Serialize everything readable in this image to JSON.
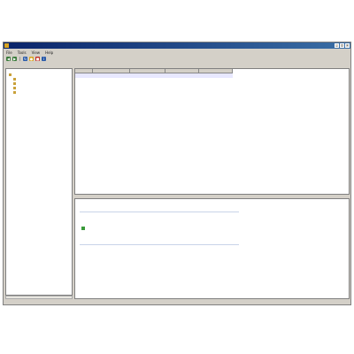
{
  "window": {
    "title": "",
    "controls": [
      "_",
      "□",
      "×"
    ]
  },
  "menubar": {
    "items": [
      "File",
      "Tools",
      "View",
      "Help"
    ]
  },
  "toolbar": {
    "tools": [
      {
        "name": "back",
        "glyph": "◀",
        "color": "#3a7a3a"
      },
      {
        "name": "forward",
        "glyph": "▶",
        "color": "#3a7a3a"
      },
      {
        "name": "refresh",
        "glyph": "↻",
        "color": "#2a5aa8"
      },
      {
        "name": "connect",
        "glyph": "●",
        "color": "#d9a521"
      },
      {
        "name": "stop",
        "glyph": "■",
        "color": "#c0281e"
      },
      {
        "name": "info",
        "glyph": "i",
        "color": "#2a5aa8"
      }
    ]
  },
  "tree": {
    "items": [
      "",
      "",
      "",
      "",
      ""
    ],
    "selected_index": 4
  },
  "list": {
    "headers": [
      "",
      "",
      "",
      "",
      ""
    ],
    "rows": [
      [
        "",
        "",
        "",
        "",
        ""
      ]
    ]
  },
  "detail": {
    "title": "",
    "subtitle": "",
    "field_label": "",
    "field_value": "",
    "link_label": "",
    "link_value": ""
  },
  "status": {
    "text": ""
  }
}
